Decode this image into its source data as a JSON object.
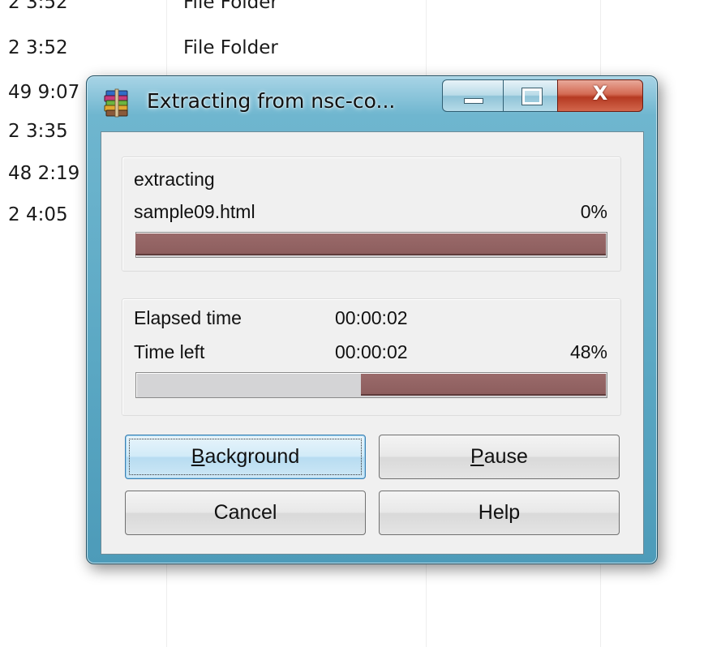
{
  "background_list": {
    "rows": [
      {
        "date": "2 3:52",
        "type": "File Folder"
      },
      {
        "date": "2 3:52",
        "type": "File Folder"
      },
      {
        "date": "49 9:07",
        "type": ""
      },
      {
        "date": "2 3:35",
        "type": ""
      },
      {
        "date": "48 2:19",
        "type": ""
      },
      {
        "date": "2 4:05",
        "type": ""
      }
    ]
  },
  "window": {
    "title": "Extracting from nsc-co...",
    "icon": "winrar-books-icon",
    "caption_buttons": {
      "minimize_icon": "minimize-icon",
      "maximize_icon": "maximize-icon",
      "close_glyph": "X"
    }
  },
  "file_group": {
    "action_label": "extracting",
    "file_name": "sample09.html",
    "percent_text": "0%",
    "progress_fraction": 1.0
  },
  "time_group": {
    "elapsed_label": "Elapsed time",
    "elapsed_value": "00:00:02",
    "left_label": "Time left",
    "left_value": "00:00:02",
    "percent_text": "48%",
    "progress_fraction": 0.48
  },
  "buttons": {
    "background": {
      "mnemonic": "B",
      "rest": "ackground"
    },
    "pause": {
      "mnemonic": "P",
      "rest": "ause"
    },
    "cancel": "Cancel",
    "help": "Help"
  },
  "colors": {
    "progress_fill": "#8d5e5e",
    "progress_track": "#d4d4d6",
    "window_frame": "#5aa7c3",
    "close_button": "#c24a30"
  }
}
